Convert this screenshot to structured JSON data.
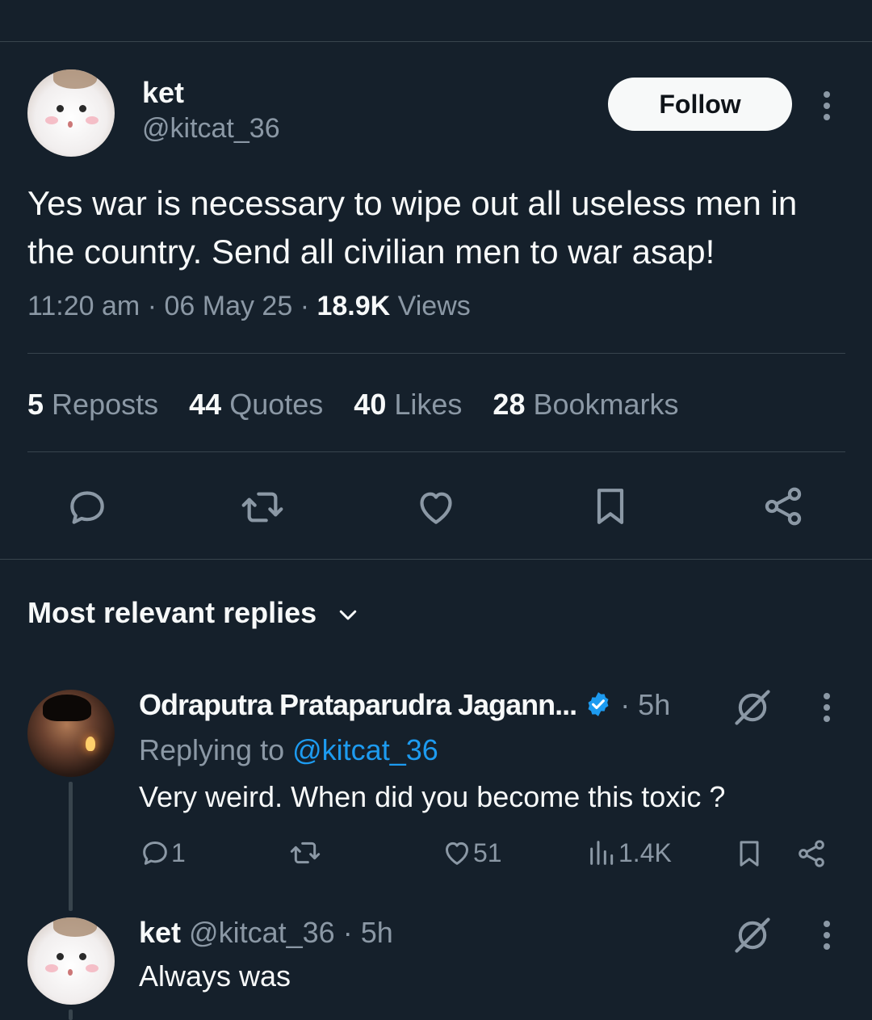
{
  "tweet": {
    "display_name": "ket",
    "handle": "@kitcat_36",
    "follow_label": "Follow",
    "text": "Yes war is necessary to wipe out all useless men in the country. Send all civilian men to war asap!",
    "time": "11:20 am",
    "date": "06 May 25",
    "views_count": "18.9K",
    "views_label": "Views",
    "separator": "·"
  },
  "stats": [
    {
      "count": "5",
      "label": "Reposts"
    },
    {
      "count": "44",
      "label": "Quotes"
    },
    {
      "count": "40",
      "label": "Likes"
    },
    {
      "count": "28",
      "label": "Bookmarks"
    }
  ],
  "action_icons": [
    "reply-icon",
    "repost-icon",
    "like-icon",
    "bookmark-icon",
    "share-icon"
  ],
  "replies_header": {
    "label": "Most relevant replies"
  },
  "replies": [
    {
      "display_name": "Odraputra Prataparudra Jagann...",
      "verified": true,
      "time": "· 5h",
      "replying_prefix": "Replying to",
      "replying_to": "@kitcat_36",
      "text": "Very weird. When did you become this toxic ?",
      "reply_count": "1",
      "repost_count": "",
      "like_count": "51",
      "view_count": "1.4K"
    },
    {
      "display_name": "ket",
      "handle": "@kitcat_36",
      "time": "· 5h",
      "text": "Always was"
    }
  ],
  "colors": {
    "background": "#15202b",
    "text": "#f7f9f9",
    "muted": "#8b98a5",
    "link": "#1d9bf0",
    "divider": "#38444d",
    "verified": "#1d9bf0"
  }
}
